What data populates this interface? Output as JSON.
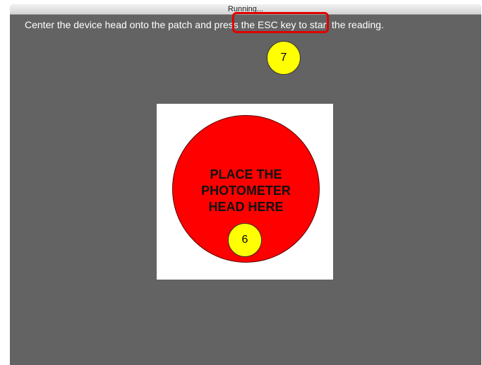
{
  "window": {
    "title": "Running..."
  },
  "instruction": {
    "before": "Center the device head onto the patch and ",
    "highlighted": "press the ESC key",
    "after": " to start the reading."
  },
  "badges": {
    "top": "7",
    "inner": "6"
  },
  "target": {
    "lines": [
      "PLACE THE",
      "PHOTOMETER",
      "HEAD HERE"
    ]
  },
  "colors": {
    "background": "#636363",
    "target": "#ff0000",
    "badge": "#ffff00",
    "highlight_border": "#e00000"
  }
}
